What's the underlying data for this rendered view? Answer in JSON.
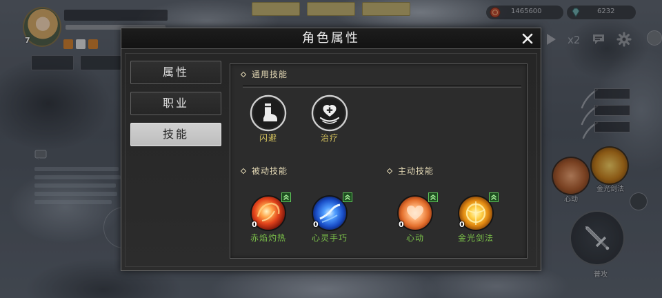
{
  "window": {
    "title": "角色属性"
  },
  "tabs": [
    {
      "label": "属性",
      "selected": false
    },
    {
      "label": "职业",
      "selected": false
    },
    {
      "label": "技能",
      "selected": true
    }
  ],
  "skills": {
    "general": {
      "title": "通用技能",
      "items": [
        {
          "name": "闪避",
          "icon": "dodge-boot-icon"
        },
        {
          "name": "治疗",
          "icon": "heal-heart-icon"
        }
      ]
    },
    "passive": {
      "title": "被动技能",
      "items": [
        {
          "name": "赤焰灼热",
          "level": "0",
          "icon": "flame-orb-icon",
          "upgradable": true
        },
        {
          "name": "心灵手巧",
          "level": "0",
          "icon": "blue-swirl-orb-icon",
          "upgradable": true
        }
      ]
    },
    "active": {
      "title": "主动技能",
      "items": [
        {
          "name": "心动",
          "level": "0",
          "icon": "heart-orb-icon",
          "upgradable": true
        },
        {
          "name": "金光剑法",
          "level": "0",
          "icon": "golden-ring-orb-icon",
          "upgradable": true
        }
      ]
    }
  },
  "hud": {
    "player": {
      "level": "7"
    },
    "currency": [
      {
        "icon": "coin-icon",
        "amount": "1465600"
      },
      {
        "icon": "diamond-icon",
        "amount": "6232"
      }
    ],
    "speed_label": "x2",
    "skill_bar": [
      {
        "name": "心动",
        "icon": "heart-orb-icon"
      },
      {
        "name": "金光剑法",
        "icon": "golden-ring-orb-icon"
      }
    ],
    "attack_label": "普攻"
  },
  "colors": {
    "general_skill_label": "#d6c45e",
    "learned_skill_label": "#7cc24a",
    "selected_tab_bg": "#c4c4c4",
    "upgrade_badge": "#5fc35a"
  }
}
